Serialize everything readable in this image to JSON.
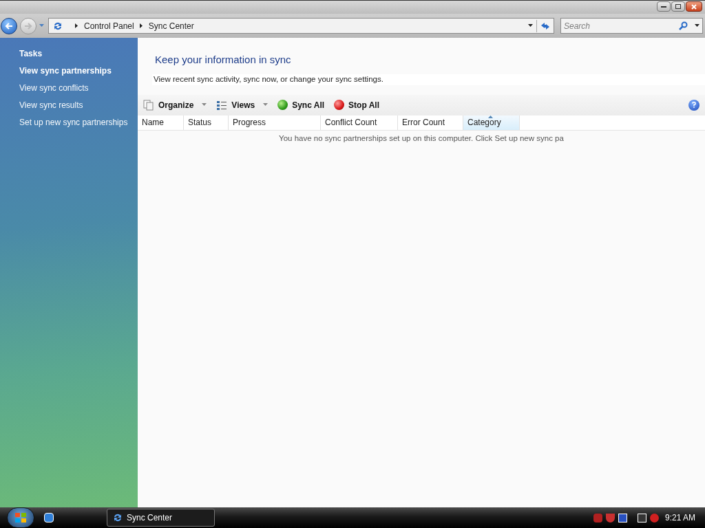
{
  "address_bar": {
    "breadcrumbs": [
      "Control Panel",
      "Sync Center"
    ]
  },
  "search": {
    "placeholder": "Search"
  },
  "sidebar": {
    "heading": "Tasks",
    "items": [
      {
        "label": "View sync partnerships",
        "selected": true
      },
      {
        "label": "View sync conflicts",
        "selected": false
      },
      {
        "label": "View sync results",
        "selected": false
      },
      {
        "label": "Set up new sync partnerships",
        "selected": false
      }
    ]
  },
  "header": {
    "title": "Keep your information in sync",
    "subtitle": "View recent sync activity, sync now, or change your sync settings."
  },
  "toolbar": [
    {
      "kind": "organize",
      "label": "Organize",
      "dropdown": true
    },
    {
      "kind": "views",
      "label": "Views",
      "dropdown": true
    },
    {
      "kind": "sync",
      "label": "Sync All",
      "dropdown": false
    },
    {
      "kind": "stop",
      "label": "Stop All",
      "dropdown": false
    }
  ],
  "table": {
    "columns": [
      {
        "label": "Name",
        "sorted": false
      },
      {
        "label": "Status",
        "sorted": false
      },
      {
        "label": "Progress",
        "sorted": false
      },
      {
        "label": "Conflict Count",
        "sorted": false
      },
      {
        "label": "Error Count",
        "sorted": false
      },
      {
        "label": "Category",
        "sorted": true
      }
    ],
    "empty_message": "You have no sync partnerships set up on this computer. Click Set up new sync pa"
  },
  "taskbar": {
    "windows": [
      {
        "label": "Sync Center",
        "selected": true
      }
    ],
    "clock": "9:21 AM"
  }
}
